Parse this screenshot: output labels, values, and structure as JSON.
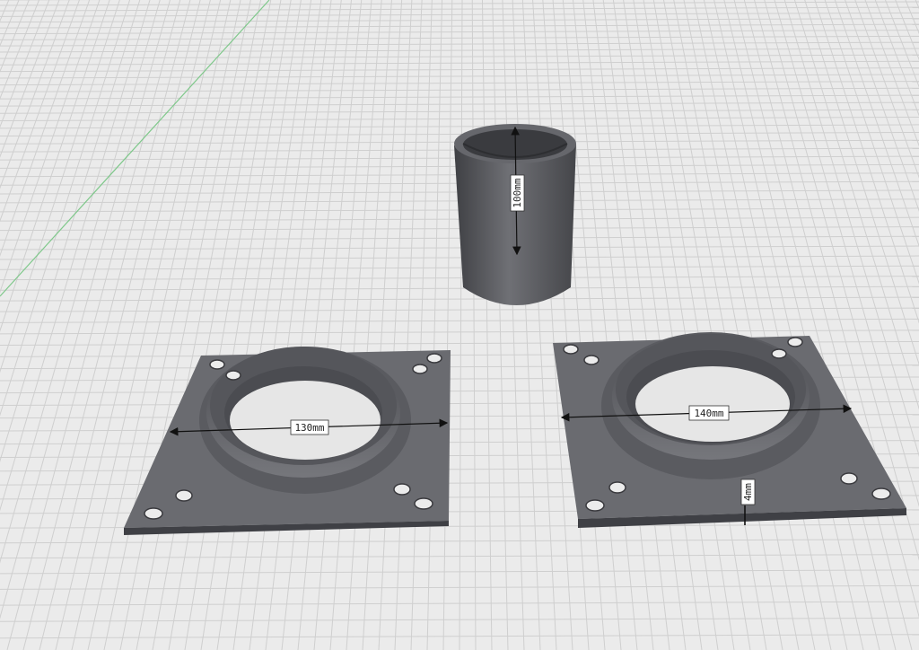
{
  "viewport": {
    "background": "#ebebeb",
    "grid_color": "#cfcfcf",
    "axis_color": "#7fc88b"
  },
  "parts": {
    "cylinder": {
      "color": "#5c5d62",
      "dimension_label": "100mm"
    },
    "flange_left": {
      "color": "#66676c",
      "diameter_label": "130mm"
    },
    "flange_right": {
      "color": "#66676c",
      "diameter_label": "140mm",
      "thickness_label": "4mm"
    }
  }
}
